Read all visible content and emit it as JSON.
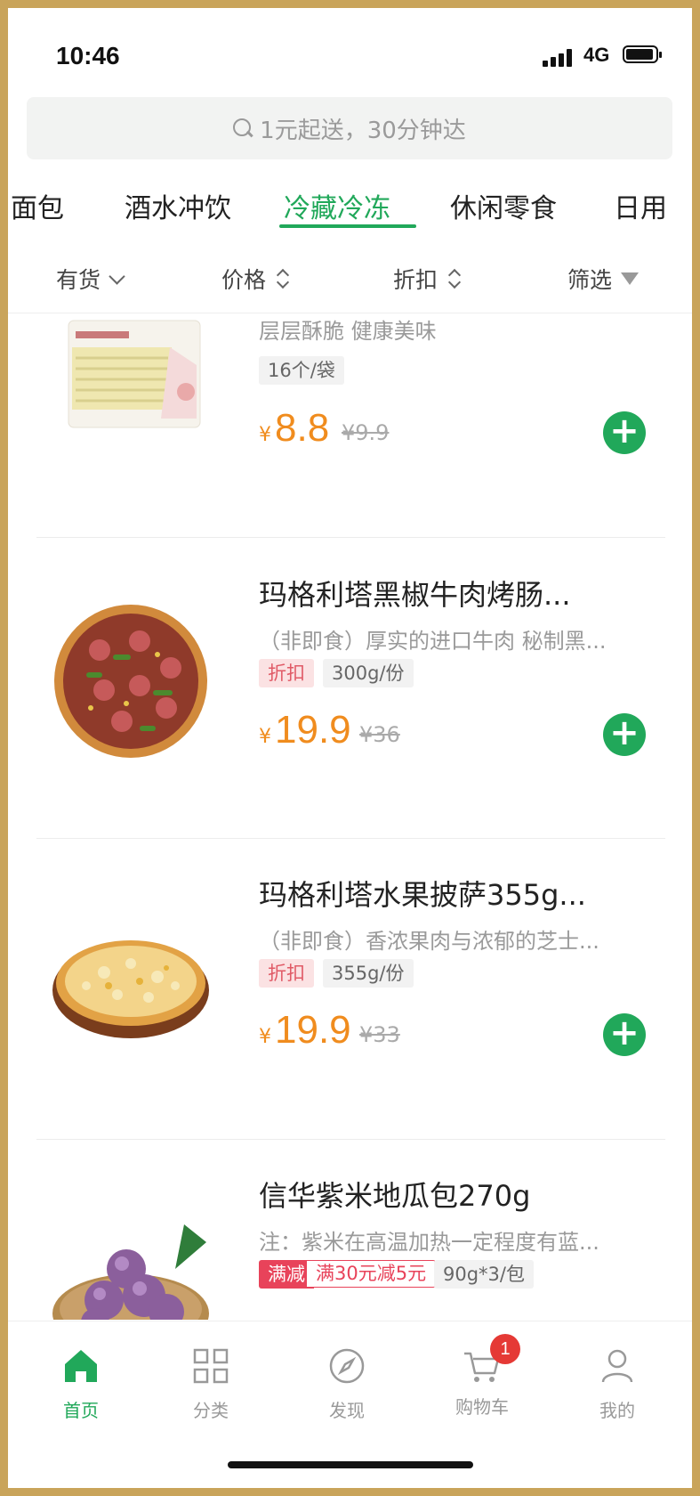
{
  "status": {
    "time": "10:46",
    "network": "4G"
  },
  "search": {
    "placeholder": "1元起送，30分钟达"
  },
  "tabs": [
    {
      "label": "面包",
      "active": false
    },
    {
      "label": "酒水冲饮",
      "active": false
    },
    {
      "label": "冷藏冷冻",
      "active": true
    },
    {
      "label": "休闲零食",
      "active": false
    },
    {
      "label": "日用",
      "active": false
    }
  ],
  "filters": [
    {
      "label": "有货",
      "icon": "check-chevron-icon"
    },
    {
      "label": "价格",
      "icon": "sort-icon"
    },
    {
      "label": "折扣",
      "icon": "sort-icon"
    },
    {
      "label": "筛选",
      "icon": "filter-icon"
    }
  ],
  "products": [
    {
      "title": "",
      "desc": "层层酥脆 健康美味",
      "tags": [
        {
          "type": "spec",
          "text": "16个/袋"
        }
      ],
      "price": "8.8",
      "original": "¥9.9",
      "currency": "¥"
    },
    {
      "title": "玛格利塔黑椒牛肉烤肠...",
      "desc": "（非即食）厚实的进口牛肉 秘制黑...",
      "tags": [
        {
          "type": "discount",
          "text": "折扣"
        },
        {
          "type": "spec",
          "text": "300g/份"
        }
      ],
      "price": "19.9",
      "original": "¥36",
      "currency": "¥"
    },
    {
      "title": "玛格利塔水果披萨355g...",
      "desc": "（非即食）香浓果肉与浓郁的芝士...",
      "tags": [
        {
          "type": "discount",
          "text": "折扣"
        },
        {
          "type": "spec",
          "text": "355g/份"
        }
      ],
      "price": "19.9",
      "original": "¥33",
      "currency": "¥"
    },
    {
      "title": "信华紫米地瓜包270g",
      "desc": "注：紫米在高温加热一定程度有蓝...",
      "tags": [
        {
          "type": "promo",
          "text": "满减"
        },
        {
          "type": "promo-detail",
          "text": "满30元减5元"
        },
        {
          "type": "spec",
          "text": "90g*3/包"
        }
      ]
    }
  ],
  "tabbar": {
    "items": [
      {
        "label": "首页",
        "icon": "home-icon",
        "active": true
      },
      {
        "label": "分类",
        "icon": "grid-icon",
        "active": false
      },
      {
        "label": "发现",
        "icon": "compass-icon",
        "active": false
      },
      {
        "label": "购物车",
        "icon": "cart-icon",
        "active": false,
        "badge": "1"
      },
      {
        "label": "我的",
        "icon": "user-icon",
        "active": false
      }
    ]
  },
  "colors": {
    "accent": "#21a85a",
    "price": "#f08c1e",
    "badge": "#e53935"
  }
}
